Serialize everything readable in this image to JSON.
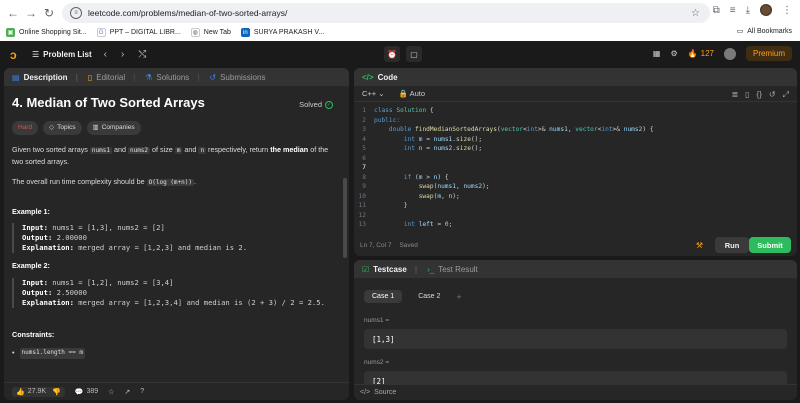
{
  "browser": {
    "url": "leetcode.com/problems/median-of-two-sorted-arrays/",
    "bookmarks": [
      "Online Shopping Sit...",
      "PPT – DIGITAL LIBR...",
      "New Tab",
      "SURYA PRAKASH V..."
    ],
    "all_bookmarks": "All Bookmarks"
  },
  "nav": {
    "problem_list": "Problem List",
    "streak": "127",
    "premium": "Premium"
  },
  "left_tabs": [
    "Description",
    "Editorial",
    "Solutions",
    "Submissions"
  ],
  "problem": {
    "title": "4. Median of Two Sorted Arrays",
    "status": "Solved",
    "difficulty": "Hard",
    "tags": [
      "Topics",
      "Companies"
    ],
    "desc_p1_a": "Given two sorted arrays ",
    "desc_p1_c1": "nums1",
    "desc_p1_b": " and ",
    "desc_p1_c2": "nums2",
    "desc_p1_c": " of size ",
    "desc_p1_c3": "m",
    "desc_p1_d": " and ",
    "desc_p1_c4": "n",
    "desc_p1_e": " respectively, return ",
    "desc_p1_bold": "the median",
    "desc_p1_f": " of the two sorted arrays.",
    "desc_p2_a": "The overall run time complexity should be ",
    "desc_p2_code": "O(log (m+n))",
    "desc_p2_b": ".",
    "examples": [
      {
        "heading": "Example 1:",
        "input_label": "Input:",
        "input": " nums1 = [1,3], nums2 = [2]",
        "output_label": "Output:",
        "output": " 2.00000",
        "expl_label": "Explanation:",
        "expl": " merged array = [1,2,3] and median is 2."
      },
      {
        "heading": "Example 2:",
        "input_label": "Input:",
        "input": " nums1 = [1,2], nums2 = [3,4]",
        "output_label": "Output:",
        "output": " 2.50000",
        "expl_label": "Explanation:",
        "expl": " merged array = [1,2,3,4] and median is (2 + 3) / 2 = 2.5."
      }
    ],
    "constraints_heading": "Constraints:",
    "constraint_1": "nums1.length == m",
    "likes": "27.9K",
    "comments": "389"
  },
  "code": {
    "tab": "Code",
    "language": "C++",
    "mode": "Auto",
    "lines": [
      "class Solution {",
      "public:",
      "    double findMedianSortedArrays(vector<int>& nums1, vector<int>& nums2) {",
      "        int m = nums1.size();",
      "        int n = nums2.size();",
      "",
      "",
      "        if (m > n) {",
      "            swap(nums1, nums2);",
      "            swap(m, n);",
      "        }",
      "",
      "        int left = 0;"
    ],
    "cursor": "Ln 7, Col 7",
    "saved": "Saved",
    "run": "Run",
    "submit": "Submit"
  },
  "testcase": {
    "tab": "Testcase",
    "result_tab": "Test Result",
    "cases": [
      "Case 1",
      "Case 2"
    ],
    "add": "+",
    "var1_label": "nums1 =",
    "var1_value": "[1,3]",
    "var2_label": "nums2 =",
    "var2_value": "[2]",
    "source": "Source"
  }
}
